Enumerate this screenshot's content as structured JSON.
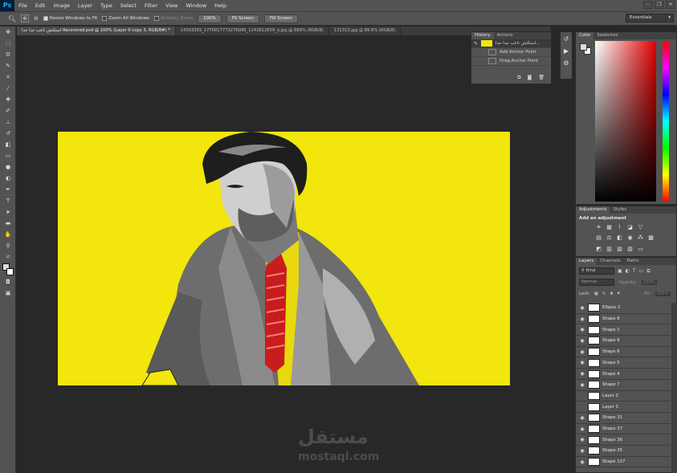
{
  "app": {
    "logo": "Ps"
  },
  "menu": [
    "File",
    "Edit",
    "Image",
    "Layer",
    "Type",
    "Select",
    "Filter",
    "View",
    "Window",
    "Help"
  ],
  "options": {
    "resize_windows": "Resize Windows to Fit",
    "zoom_all": "Zoom All Windows",
    "scrubby": "Scrubby Zoom",
    "btn_100": "100%",
    "btn_fit": "Fit Screen",
    "btn_fill": "Fill Screen",
    "workspace": "Essentials"
  },
  "tabs": [
    "استكتش تاعب جدا جدا Recovered.psd @ 100% (Layer 0 copy 3, RGB/8#) *",
    "14393383_1770017773276095_1142812659_o.jpg @ 689% (RGB/8)",
    "131313.jpg @ 89.6% (RGB/8)"
  ],
  "history": {
    "tab_history": "History",
    "tab_actions": "Actions",
    "rows": [
      "استكتش تاعب جدا جدا...",
      "Add Anchor Point",
      "Drag Anchor Point"
    ]
  },
  "colorpanel": {
    "tab_color": "Color",
    "tab_swatches": "Swatches"
  },
  "adjustments": {
    "tab_adjust": "Adjustments",
    "tab_styles": "Styles",
    "title": "Add an adjustment"
  },
  "layers": {
    "tabs": [
      "Layers",
      "Channels",
      "Paths"
    ],
    "kind": "Kind",
    "blend": "Normal",
    "opacity_label": "Opacity:",
    "opacity": "100%",
    "lock_label": "Lock:",
    "fill_label": "Fill:",
    "fill": "100%",
    "items": [
      "Ellipse 2",
      "Shape 8",
      "Shape 1",
      "Shape 9",
      "Shape 6",
      "Shape 5",
      "Shape 4",
      "Shape 7",
      "Layer 2",
      "Layer 3",
      "Shape 31",
      "Shape 37",
      "Shape 36",
      "Shape 35",
      "Shape 127"
    ]
  },
  "watermark": {
    "arabic": "مستقل",
    "latin": "mostaql.com"
  },
  "colors": {
    "canvas": "#f2e60c",
    "panel": "#535353",
    "workspace": "#282828"
  }
}
